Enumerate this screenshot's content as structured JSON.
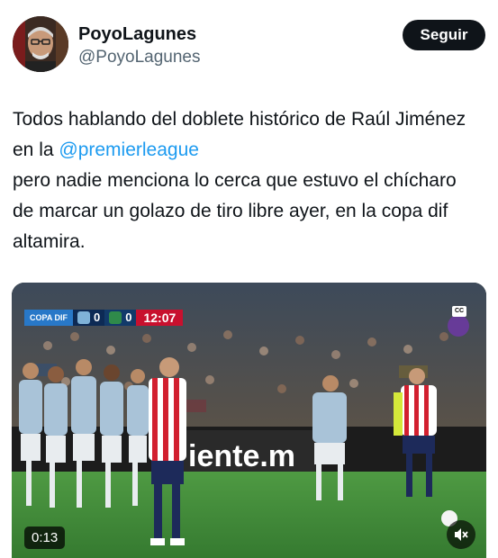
{
  "header": {
    "display_name": "PoyoLagunes",
    "handle": "@PoyoLagunes",
    "follow_label": "Seguir"
  },
  "tweet": {
    "text_before_mention": "Todos hablando del doblete histórico de Raúl Jiménez en la ",
    "mention": "@premierleague",
    "text_after_mention": "pero nadie menciona lo cerca que estuvo el chícharo de marcar un golazo de tiro libre ayer, en la copa dif altamira."
  },
  "video": {
    "scorebug": {
      "league": "COPA DIF",
      "home_score": "0",
      "away_score": "0",
      "clock": "12:07"
    },
    "board_text": "iente.m",
    "duration": "0:13",
    "cc_label": "CC"
  },
  "colors": {
    "mention": "#1d9bf0",
    "follow_bg": "#0f1419",
    "pitch": "#3f8a3a"
  }
}
